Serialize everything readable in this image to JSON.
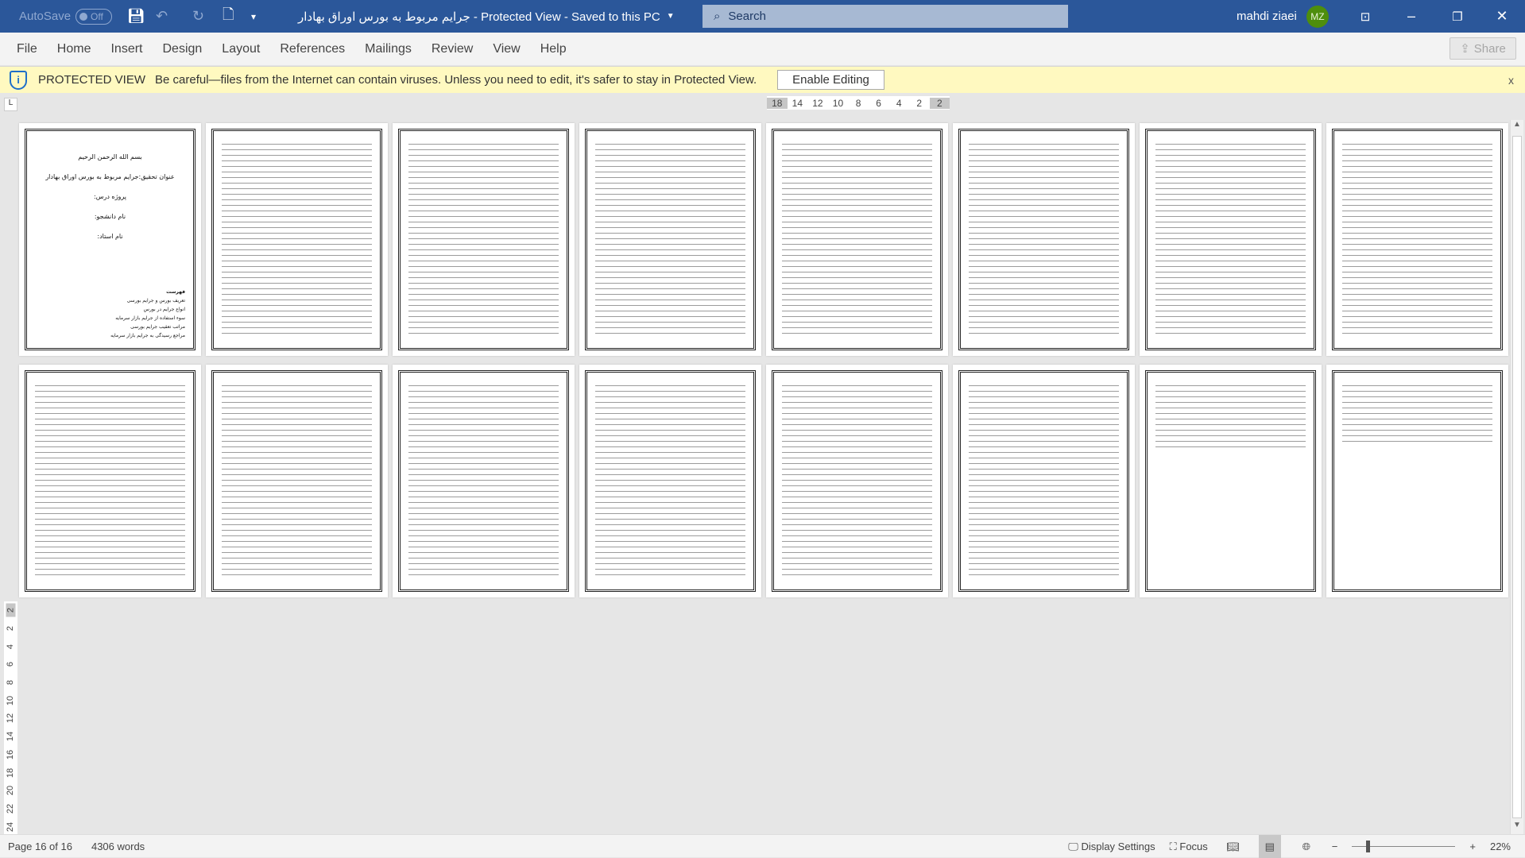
{
  "titlebar": {
    "autosave": "AutoSave",
    "autosave_state": "Off",
    "title": "جرایم مربوط به بورس اوراق بهادار  -  Protected View  -  Saved to this PC",
    "search_placeholder": "Search",
    "user": "mahdi ziaei",
    "initials": "MZ",
    "avatar_color": "#4e8e0d"
  },
  "tabs": [
    "File",
    "Home",
    "Insert",
    "Design",
    "Layout",
    "References",
    "Mailings",
    "Review",
    "View",
    "Help"
  ],
  "share": "Share",
  "protected": {
    "label": "PROTECTED VIEW",
    "message": "Be careful—files from the Internet can contain viruses. Unless you need to edit, it's safer to stay in Protected View.",
    "button": "Enable Editing",
    "close": "x"
  },
  "ruler": {
    "h": [
      "18",
      "14",
      "12",
      "10",
      "8",
      "6",
      "4",
      "2",
      "2"
    ],
    "v": [
      "2",
      "2",
      "4",
      "6",
      "8",
      "10",
      "12",
      "14",
      "16",
      "18",
      "20",
      "22",
      "24"
    ]
  },
  "page1": {
    "line1": "بسم الله الرحمن الرحیم",
    "line2": "عنوان تحقیق:جرایم مربوط به بورس اوراق بهادار",
    "line3": "پروژه درس:",
    "line4": "نام دانشجو:",
    "line5": "نام استاد:",
    "toc_title": "فهرست",
    "toc": [
      "تعریف بورس و جرایم بورسی",
      "انواع جرایم در بورس",
      "سوء استفاده از جرایم بازار سرمایه",
      "مراتب تعقیب جرایم بورسی",
      "مراجع رسیدگی به جرایم بازار سرمایه"
    ]
  },
  "status": {
    "page": "Page 16 of 16",
    "words": "4306 words",
    "display": "Display Settings",
    "focus": "Focus",
    "zoom": "22%"
  }
}
